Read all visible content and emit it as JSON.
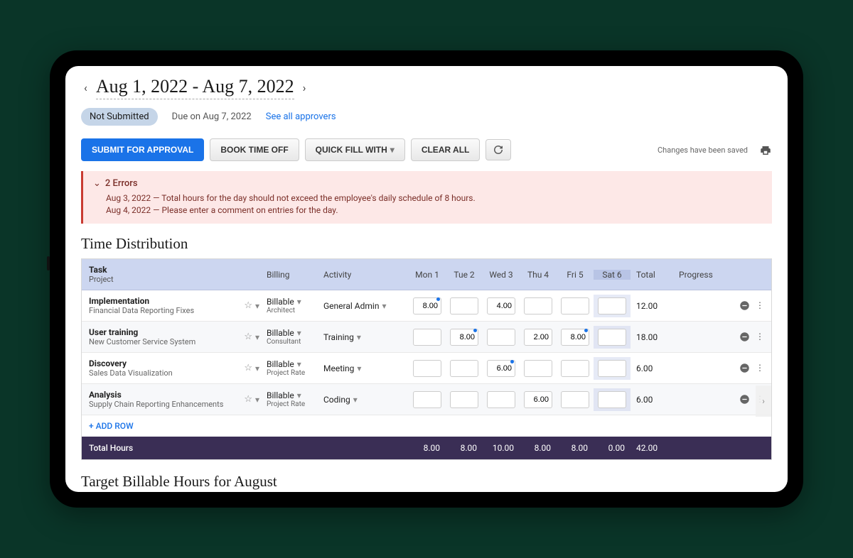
{
  "dateRange": "Aug 1, 2022 - Aug 7, 2022",
  "status": {
    "badge": "Not Submitted",
    "due": "Due on Aug 7, 2022",
    "approversLink": "See all approvers"
  },
  "toolbar": {
    "submit": "SUBMIT FOR APPROVAL",
    "bookTimeOff": "BOOK TIME OFF",
    "quickFill": "QUICK FILL WITH",
    "clearAll": "CLEAR ALL",
    "savedText": "Changes have been saved"
  },
  "errors": {
    "header": "2 Errors",
    "items": [
      "Aug 3, 2022 — Total hours for the day should not exceed the employee's daily schedule of 8 hours.",
      "Aug 4, 2022 — Please enter a comment on entries for the day."
    ]
  },
  "sections": {
    "timeDist": "Time Distribution",
    "targetBillable": "Target Billable Hours for August"
  },
  "headers": {
    "task": "Task",
    "project": "Project",
    "billing": "Billing",
    "activity": "Activity",
    "days": [
      "Mon 1",
      "Tue 2",
      "Wed 3",
      "Thu 4",
      "Fri 5",
      "Sat 6"
    ],
    "total": "Total",
    "progress": "Progress"
  },
  "rows": [
    {
      "task": "Implementation",
      "project": "Financial Data Reporting Fixes",
      "billing": "Billable",
      "rate": "Architect",
      "activity": "General Admin",
      "days": [
        "8.00",
        "",
        "4.00",
        "",
        "",
        ""
      ],
      "dots": [
        true,
        false,
        false,
        false,
        false,
        false
      ],
      "total": "12.00"
    },
    {
      "task": "User training",
      "project": "New Customer Service System",
      "billing": "Billable",
      "rate": "Consultant",
      "activity": "Training",
      "days": [
        "",
        "8.00",
        "",
        "2.00",
        "8.00",
        ""
      ],
      "dots": [
        false,
        true,
        false,
        false,
        true,
        false
      ],
      "total": "18.00"
    },
    {
      "task": "Discovery",
      "project": "Sales Data Visualization",
      "billing": "Billable",
      "rate": "Project Rate",
      "activity": "Meeting",
      "days": [
        "",
        "",
        "6.00",
        "",
        "",
        ""
      ],
      "dots": [
        false,
        false,
        true,
        false,
        false,
        false
      ],
      "total": "6.00"
    },
    {
      "task": "Analysis",
      "project": "Supply Chain Reporting Enhancements",
      "billing": "Billable",
      "rate": "Project Rate",
      "activity": "Coding",
      "days": [
        "",
        "",
        "",
        "6.00",
        "",
        ""
      ],
      "dots": [
        false,
        false,
        false,
        false,
        false,
        false
      ],
      "total": "6.00"
    }
  ],
  "addRow": "+ ADD ROW",
  "totals": {
    "label": "Total Hours",
    "days": [
      "8.00",
      "8.00",
      "10.00",
      "8.00",
      "8.00",
      "0.00"
    ],
    "total": "42.00"
  }
}
